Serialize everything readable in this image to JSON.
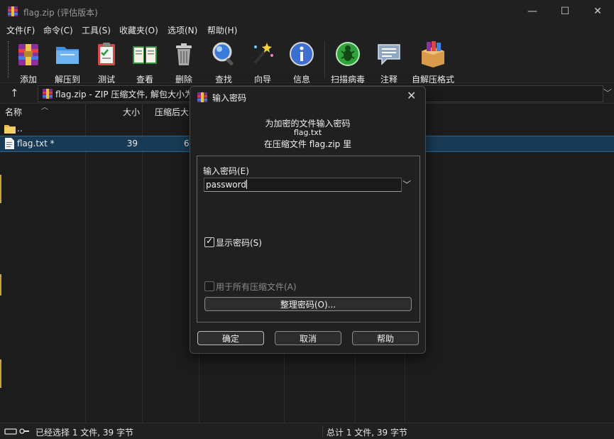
{
  "window": {
    "title": "flag.zip (评估版本)"
  },
  "menu": [
    "文件(F)",
    "命令(C)",
    "工具(S)",
    "收藏夹(O)",
    "选项(N)",
    "帮助(H)"
  ],
  "toolbar": [
    {
      "label": "添加",
      "icon": "add-archive-icon"
    },
    {
      "label": "解压到",
      "icon": "extract-to-folder-icon"
    },
    {
      "label": "测试",
      "icon": "test-clipboard-icon"
    },
    {
      "label": "查看",
      "icon": "view-book-icon"
    },
    {
      "label": "删除",
      "icon": "delete-trash-icon"
    },
    {
      "label": "查找",
      "icon": "find-magnifier-icon"
    },
    {
      "label": "向导",
      "icon": "wizard-wand-icon"
    },
    {
      "label": "信息",
      "icon": "info-icon"
    },
    {
      "label": "扫描病毒",
      "icon": "scan-virus-icon"
    },
    {
      "label": "注释",
      "icon": "comment-bubble-icon"
    },
    {
      "label": "自解压格式",
      "icon": "sfx-box-icon"
    }
  ],
  "address": {
    "text": "flag.zip - ZIP 压缩文件, 解包大小为"
  },
  "columns": [
    "名称",
    "大小",
    "压缩后大小"
  ],
  "rows": [
    {
      "name": "..",
      "size": "",
      "packed": "",
      "selected": false
    },
    {
      "name": "flag.txt *",
      "size": "39",
      "packed": "6",
      "selected": true
    }
  ],
  "status": {
    "left": "已经选择 1 文件, 39 字节",
    "right": "总计 1 文件, 39 字节"
  },
  "dialog": {
    "title": "输入密码",
    "line1": "为加密的文件输入密码",
    "line2": "flag.txt",
    "line3": "在压缩文件 flag.zip 里",
    "password_label": "输入密码(E)",
    "password_value": "password",
    "show_password_label": "显示密码(S)",
    "show_password_checked": true,
    "use_all_label": "用于所有压缩文件(A)",
    "use_all_checked": false,
    "organize_button": "整理密码(O)...",
    "ok_button": "确定",
    "cancel_button": "取消",
    "help_button": "帮助"
  },
  "colors": {
    "accent_selection": "#183a55",
    "background": "#1c1c1c"
  }
}
